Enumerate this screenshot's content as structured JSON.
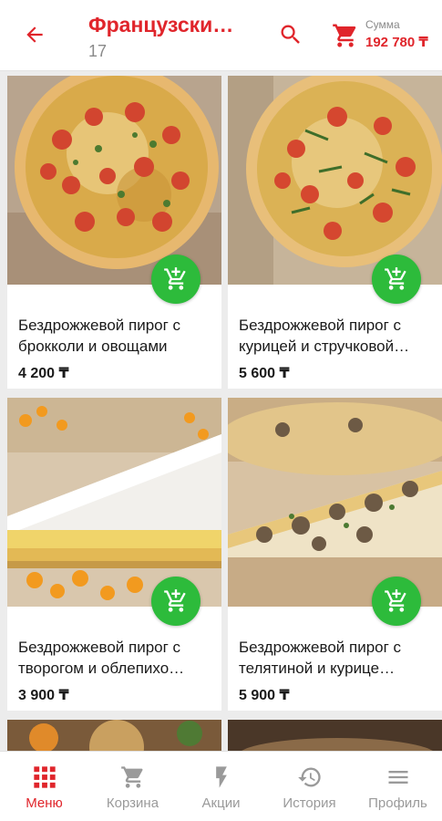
{
  "colors": {
    "brand_red": "#e0252b",
    "add_green": "#2dbb3b",
    "muted": "#8a8a8a"
  },
  "header": {
    "title": "Французски…",
    "subtitle": "17",
    "sum_label": "Сумма",
    "sum_value": "192 780 ₸",
    "icons": {
      "back": "arrow-back-icon",
      "search": "search-icon",
      "cart": "cart-icon"
    }
  },
  "products": [
    {
      "name": "Бездрожжевой пирог с брокколи и овощами",
      "price": "4 200 ₸"
    },
    {
      "name": "Бездрожжевой пирог с курицей и стручковой…",
      "price": "5 600 ₸"
    },
    {
      "name": "Бездрожжевой пирог с творогом и облепихо…",
      "price": "3 900 ₸"
    },
    {
      "name": "Бездрожжевой пирог с телятиной и курице…",
      "price": "5 900 ₸"
    }
  ],
  "bottom_nav": {
    "items": [
      {
        "label": "Меню",
        "icon": "grid-icon",
        "active": true
      },
      {
        "label": "Корзина",
        "icon": "cart-icon",
        "active": false
      },
      {
        "label": "Акции",
        "icon": "lightning-icon",
        "active": false
      },
      {
        "label": "История",
        "icon": "history-icon",
        "active": false
      },
      {
        "label": "Профиль",
        "icon": "menu-icon",
        "active": false
      }
    ]
  }
}
